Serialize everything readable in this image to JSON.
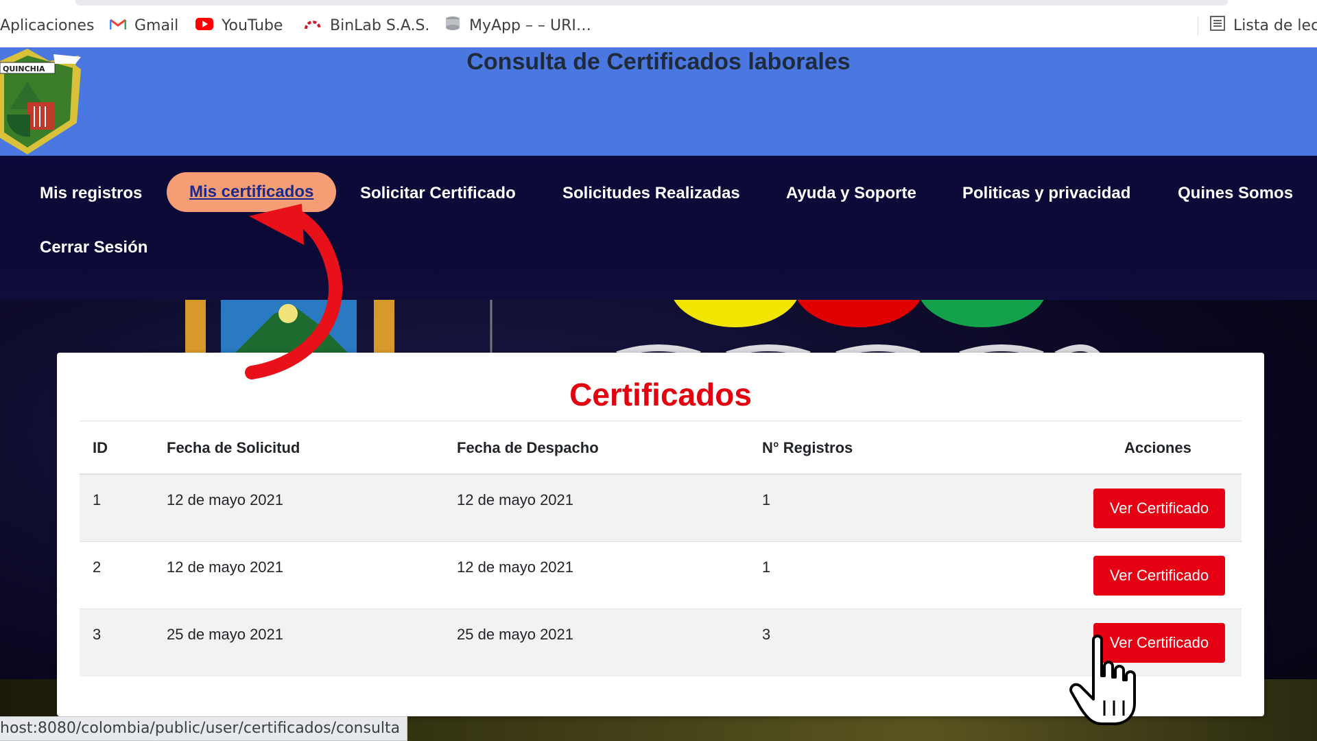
{
  "bookmarks_bar": {
    "items": [
      {
        "label": "Aplicaciones",
        "icon": "apps-icon"
      },
      {
        "label": "Gmail",
        "icon": "gmail-icon"
      },
      {
        "label": "YouTube",
        "icon": "youtube-icon"
      },
      {
        "label": "BinLab S.A.S.",
        "icon": "binlab-icon"
      },
      {
        "label": "MyApp – – URI…",
        "icon": "myapp-icon"
      }
    ],
    "reading_list": {
      "label": "Lista de lec",
      "icon": "reading-list-icon"
    }
  },
  "header": {
    "title": "Consulta de Certificados laborales",
    "logo_alt": "QUINCHIA",
    "background": "#4a78e0"
  },
  "nav": {
    "items": [
      {
        "label": "Mis registros"
      },
      {
        "label": "Mis certificados",
        "active": true
      },
      {
        "label": "Solicitar Certificado"
      },
      {
        "label": "Solicitudes Realizadas"
      },
      {
        "label": "Ayuda y Soporte"
      },
      {
        "label": "Politicas y privacidad"
      },
      {
        "label": "Quines Somos"
      },
      {
        "label": "Cerrar Sesión"
      }
    ],
    "active_color": "#f59d74"
  },
  "main": {
    "title": "Certificados",
    "title_color": "#e3000f",
    "table": {
      "headers": [
        "ID",
        "Fecha de Solicitud",
        "Fecha de Despacho",
        "N° Registros",
        "Acciones"
      ],
      "rows": [
        {
          "id": "1",
          "fecha_solicitud": "12 de mayo 2021",
          "fecha_despacho": "12 de mayo 2021",
          "registros": "1",
          "action": "Ver Certificado"
        },
        {
          "id": "2",
          "fecha_solicitud": "12 de mayo 2021",
          "fecha_despacho": "12 de mayo 2021",
          "registros": "1",
          "action": "Ver Certificado"
        },
        {
          "id": "3",
          "fecha_solicitud": "25 de mayo 2021",
          "fecha_despacho": "25 de mayo 2021",
          "registros": "3",
          "action": "Ver Certificado"
        }
      ],
      "button_color": "#e60013"
    }
  },
  "status_bar": {
    "url": "host:8080/colombia/public/user/certificados/consulta"
  },
  "overlays": {
    "arrow_icon": "curved-arrow-icon",
    "cursor_icon": "hand-pointer-icon",
    "arrow_color": "#e8111a"
  }
}
